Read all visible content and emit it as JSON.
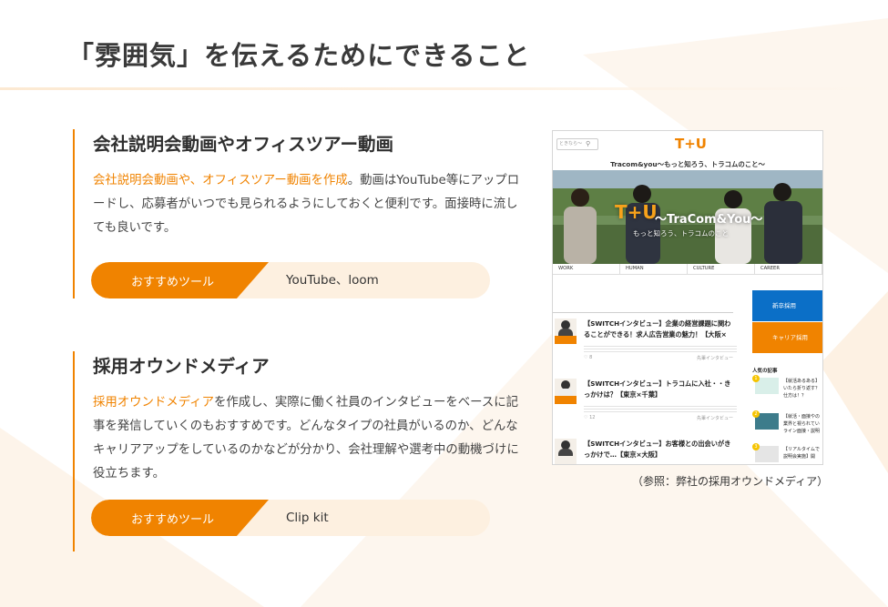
{
  "page": {
    "title": "「雰囲気」を伝えるためにできること"
  },
  "sections": [
    {
      "heading": "会社説明会動画やオフィスツアー動画",
      "highlight": "会社説明会動画や、オフィスツアー動画を作成",
      "body_line1_rest": "。動画はYouTube等に",
      "body_rest": "アップロードし、応募者がいつでも見られるようにしておくと便利です。面接時に流しても良いです。",
      "tool_label": "おすすめツール",
      "tool_value": "YouTube、loom"
    },
    {
      "heading": "採用オウンドメディア",
      "highlight": "採用オウンドメディア",
      "body_rest": "を作成し、実際に働く社員のインタビューをベースに記事を発信していくのもおすすめです。どんなタイプの社員がいるのか、どんなキャリアアップをしているのかなどが分かり、会社理解や選考中の動機づけに役立ちます。",
      "tool_label": "おすすめツール",
      "tool_value": "Clip kit"
    }
  ],
  "screenshot": {
    "search_placeholder": "ときなら〜",
    "search_icon": "magnifier-icon",
    "logo": "T+U",
    "tagline": "Tracom&you〜もっと知ろう、トラコムのこと〜",
    "hero_logo": "T+U",
    "hero_brand": "〜TraCom&You〜",
    "hero_sub": "もっと知ろう、トラコムのこと",
    "nav": [
      "WORK",
      "HUMAN",
      "CULTURE",
      "CAREER"
    ],
    "articles": [
      {
        "title": "【SWITCHインタビュー】企業の経営課題に関わることができる！求人広告営業の魅力！【大阪×",
        "thumb_label": "うぴょー",
        "likes": "8",
        "category": "先輩インタビュー"
      },
      {
        "title": "【SWITCHインタビュー】トラコムに入社・・きっかけは？【東京×千葉】",
        "thumb_label": "うぴょー",
        "likes": "12",
        "category": "先輩インタビュー"
      },
      {
        "title": "【SWITCHインタビュー】お客様との出会いがきっかけで…【東京×大阪】",
        "thumb_label": "",
        "likes": "",
        "category": ""
      }
    ],
    "cta_new_grad": "新卒採用",
    "cta_career": "キャリア採用",
    "popular_title": "人気の記事",
    "popular": [
      {
        "num": "1",
        "text": "【就活あるある】\nいたら折り返す？\n仕方は！？"
      },
      {
        "num": "2",
        "text": "【就活・面接やの\n業界と視られてい\nライン面接・説明"
      },
      {
        "num": "3",
        "text": "【リアルタイムで\n説明会実施】開"
      }
    ],
    "colors": {
      "accent": "#f08300",
      "blue": "#0b6fc7"
    }
  },
  "caption": "（参照：弊社の採用オウンドメディア）"
}
